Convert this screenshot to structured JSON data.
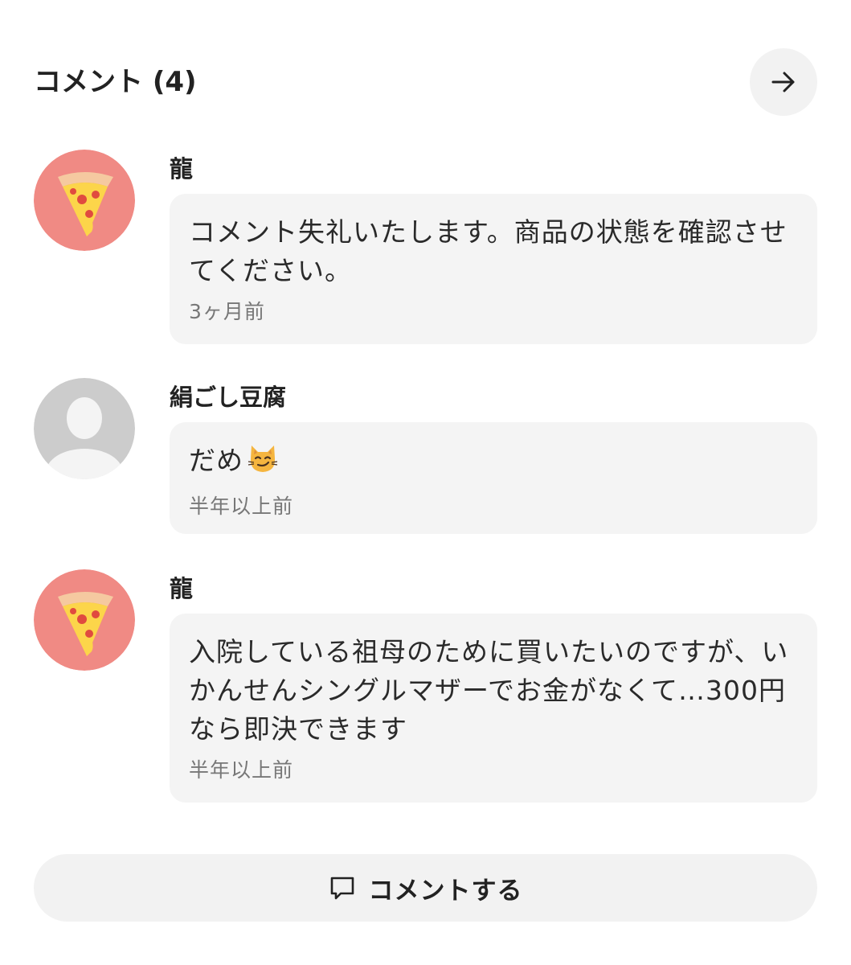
{
  "header": {
    "title": "コメント (4)",
    "next_icon": "arrow-right-icon"
  },
  "comments": [
    {
      "name": "龍",
      "avatar": "pizza-avatar",
      "text": "コメント失礼いたします。商品の状態を確認させてください。",
      "time": "3ヶ月前"
    },
    {
      "name": "絹ごし豆腐",
      "avatar": "default-user-avatar",
      "text": "だめ",
      "emoji": "smirking-cat-emoji",
      "time": "半年以上前"
    },
    {
      "name": "龍",
      "avatar": "pizza-avatar",
      "text": "入院している祖母のために買いたいのですが、いかんせんシングルマザーでお金がなくて…300円なら即決できます",
      "time": "半年以上前"
    }
  ],
  "footer": {
    "comment_button_label": "コメントする",
    "comment_icon": "speech-bubble-icon"
  },
  "colors": {
    "bubble_background": "#f4f4f4",
    "button_background": "#f2f2f2",
    "avatar_pink": "#f08a84",
    "default_avatar": "#cccccc"
  }
}
